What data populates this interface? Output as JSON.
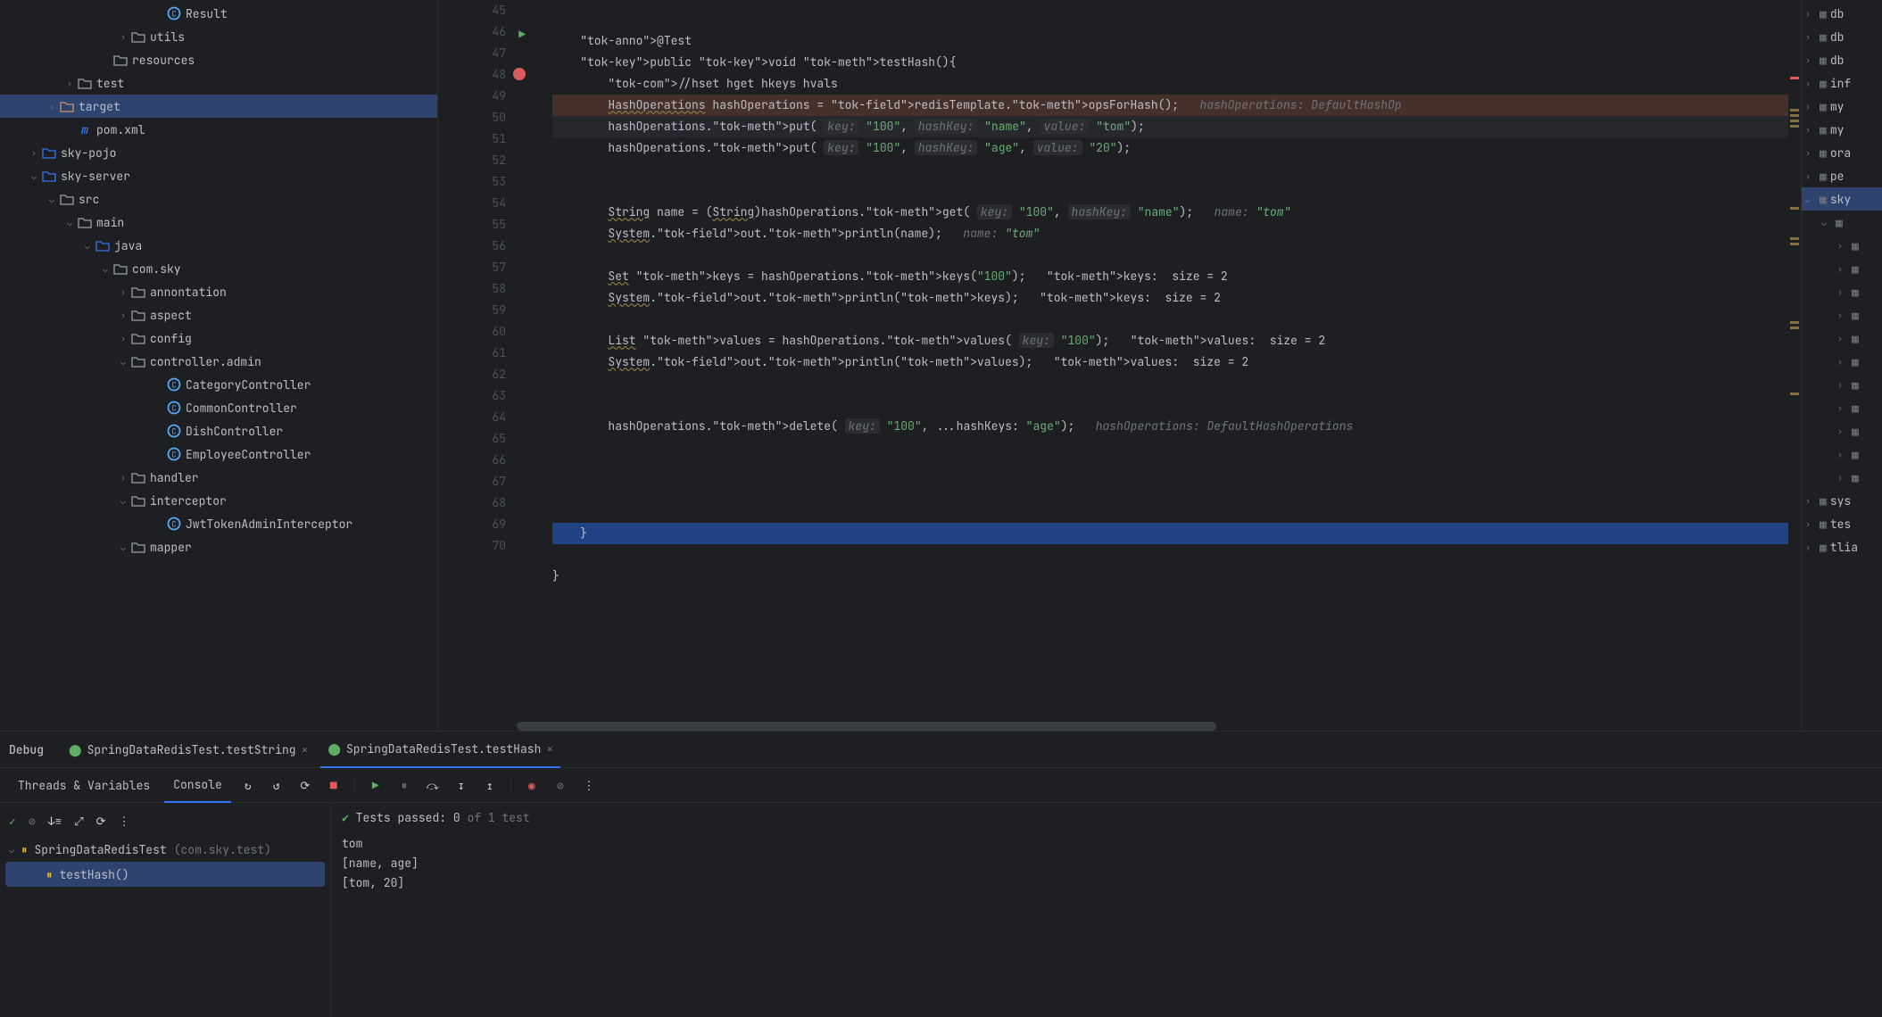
{
  "project": {
    "nodes": [
      {
        "indent": 170,
        "arrow": "",
        "icon": "cls",
        "label": "Result"
      },
      {
        "indent": 130,
        "arrow": ">",
        "icon": "fold",
        "label": "utils"
      },
      {
        "indent": 110,
        "arrow": "",
        "icon": "fold",
        "label": "resources"
      },
      {
        "indent": 70,
        "arrow": ">",
        "icon": "fold",
        "label": "test"
      },
      {
        "indent": 50,
        "arrow": ">",
        "icon": "fold-orange",
        "label": "target",
        "selected": true
      },
      {
        "indent": 70,
        "arrow": "",
        "icon": "maven",
        "label": "pom.xml"
      },
      {
        "indent": 30,
        "arrow": ">",
        "icon": "fold-blue",
        "label": "sky-pojo"
      },
      {
        "indent": 30,
        "arrow": "v",
        "icon": "fold-blue",
        "label": "sky-server"
      },
      {
        "indent": 50,
        "arrow": "v",
        "icon": "fold",
        "label": "src"
      },
      {
        "indent": 70,
        "arrow": "v",
        "icon": "fold",
        "label": "main"
      },
      {
        "indent": 90,
        "arrow": "v",
        "icon": "fold-blue",
        "label": "java"
      },
      {
        "indent": 110,
        "arrow": "v",
        "icon": "fold",
        "label": "com.sky"
      },
      {
        "indent": 130,
        "arrow": ">",
        "icon": "fold",
        "label": "annontation"
      },
      {
        "indent": 130,
        "arrow": ">",
        "icon": "fold",
        "label": "aspect"
      },
      {
        "indent": 130,
        "arrow": ">",
        "icon": "fold",
        "label": "config"
      },
      {
        "indent": 130,
        "arrow": "v",
        "icon": "fold",
        "label": "controller.admin"
      },
      {
        "indent": 170,
        "arrow": "",
        "icon": "cls",
        "label": "CategoryController"
      },
      {
        "indent": 170,
        "arrow": "",
        "icon": "cls",
        "label": "CommonController"
      },
      {
        "indent": 170,
        "arrow": "",
        "icon": "cls",
        "label": "DishController"
      },
      {
        "indent": 170,
        "arrow": "",
        "icon": "cls",
        "label": "EmployeeController"
      },
      {
        "indent": 130,
        "arrow": ">",
        "icon": "fold",
        "label": "handler"
      },
      {
        "indent": 130,
        "arrow": "v",
        "icon": "fold",
        "label": "interceptor"
      },
      {
        "indent": 170,
        "arrow": "",
        "icon": "cls",
        "label": "JwtTokenAdminInterceptor"
      },
      {
        "indent": 130,
        "arrow": "v",
        "icon": "fold",
        "label": "mapper"
      }
    ]
  },
  "editor": {
    "first_line": 45,
    "lines": [
      {
        "n": 45,
        "txt": "    @Test",
        "cls": ""
      },
      {
        "n": 46,
        "txt": "    public void testHash(){",
        "run": true
      },
      {
        "n": 47,
        "txt": "        //hset hget hkeys hvals"
      },
      {
        "n": 48,
        "txt": "        HashOperations hashOperations = redisTemplate.opsForHash();   hashOperations: DefaultHashOp",
        "bp": true,
        "err": true
      },
      {
        "n": 49,
        "txt": "        hashOperations.put( key: \"100\", hashKey: \"name\", value: \"tom\");",
        "cur": true
      },
      {
        "n": 50,
        "txt": "        hashOperations.put( key: \"100\", hashKey: \"age\", value: \"20\");"
      },
      {
        "n": 51,
        "txt": ""
      },
      {
        "n": 52,
        "txt": ""
      },
      {
        "n": 53,
        "txt": "        String name = (String)hashOperations.get( key: \"100\", hashKey: \"name\");   name: \"tom\""
      },
      {
        "n": 54,
        "txt": "        System.out.println(name);   name: \"tom\""
      },
      {
        "n": 55,
        "txt": ""
      },
      {
        "n": 56,
        "txt": "        Set keys = hashOperations.keys(\"100\");   keys:  size = 2"
      },
      {
        "n": 57,
        "txt": "        System.out.println(keys);   keys:  size = 2"
      },
      {
        "n": 58,
        "txt": ""
      },
      {
        "n": 59,
        "txt": "        List values = hashOperations.values( key: \"100\");   values:  size = 2"
      },
      {
        "n": 60,
        "txt": "        System.out.println(values);   values:  size = 2"
      },
      {
        "n": 61,
        "txt": ""
      },
      {
        "n": 62,
        "txt": ""
      },
      {
        "n": 63,
        "txt": "        hashOperations.delete( key: \"100\", ...hashKeys: \"age\");   hashOperations: DefaultHashOperations"
      },
      {
        "n": 64,
        "txt": ""
      },
      {
        "n": 65,
        "txt": ""
      },
      {
        "n": 66,
        "txt": ""
      },
      {
        "n": 67,
        "txt": ""
      },
      {
        "n": 68,
        "txt": "    }",
        "sel": true
      },
      {
        "n": 69,
        "txt": ""
      },
      {
        "n": 70,
        "txt": "}"
      }
    ]
  },
  "right": {
    "items": [
      {
        "arrow": ">",
        "label": "db"
      },
      {
        "arrow": ">",
        "label": "db"
      },
      {
        "arrow": ">",
        "label": "db"
      },
      {
        "arrow": ">",
        "label": "inf"
      },
      {
        "arrow": ">",
        "label": "my"
      },
      {
        "arrow": ">",
        "label": "my"
      },
      {
        "arrow": ">",
        "label": "ora"
      },
      {
        "arrow": ">",
        "label": "pe"
      },
      {
        "arrow": "v",
        "label": "sky",
        "selected": true
      },
      {
        "arrow": "v",
        "label": "",
        "sub": true
      },
      {
        "arrow": ">",
        "label": "",
        "sub2": true
      },
      {
        "arrow": ">",
        "label": "",
        "sub2": true
      },
      {
        "arrow": ">",
        "label": "",
        "sub2": true
      },
      {
        "arrow": ">",
        "label": "",
        "sub2": true
      },
      {
        "arrow": ">",
        "label": "",
        "sub2": true
      },
      {
        "arrow": ">",
        "label": "",
        "sub2": true
      },
      {
        "arrow": ">",
        "label": "",
        "sub2": true
      },
      {
        "arrow": ">",
        "label": "",
        "sub2": true
      },
      {
        "arrow": ">",
        "label": "",
        "sub2": true
      },
      {
        "arrow": ">",
        "label": "",
        "sub2": true
      },
      {
        "arrow": ">",
        "label": "",
        "sub2": true
      },
      {
        "arrow": ">",
        "label": "sys"
      },
      {
        "arrow": ">",
        "label": "tes"
      },
      {
        "arrow": ">",
        "label": "tlia"
      }
    ]
  },
  "debug": {
    "title": "Debug",
    "tabs": [
      {
        "label": "SpringDataRedisTest.testString",
        "active": false
      },
      {
        "label": "SpringDataRedisTest.testHash",
        "active": true
      }
    ],
    "tooltabs": {
      "threads": "Threads & Variables",
      "console": "Console"
    },
    "tests": {
      "prefix": "Tests passed: ",
      "count": "0",
      "suffix": " of 1 test"
    },
    "tree": {
      "root": "SpringDataRedisTest",
      "root_pkg": "(com.sky.test)",
      "child": "testHash()"
    },
    "output": [
      "tom",
      "[name, age]",
      "[tom, 20]"
    ]
  }
}
